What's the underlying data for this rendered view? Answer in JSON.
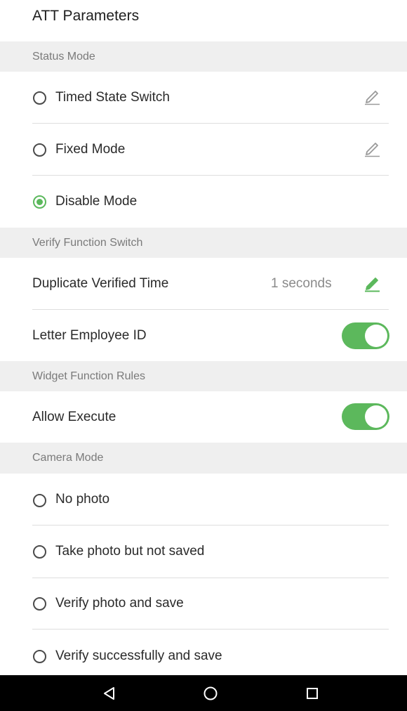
{
  "header": {
    "title": "ATT Parameters"
  },
  "sections": {
    "status_mode": "Status Mode",
    "verify_function": "Verify Function Switch",
    "widget_rules": "Widget Function Rules",
    "camera_mode": "Camera Mode"
  },
  "status_mode": {
    "timed_state_switch": "Timed State Switch",
    "fixed_mode": "Fixed Mode",
    "disable_mode": "Disable Mode",
    "selected": "Disable Mode"
  },
  "verify_function": {
    "duplicate_verified_time": {
      "label": "Duplicate Verified Time",
      "value": "1 seconds"
    },
    "letter_employee_id": {
      "label": "Letter Employee ID",
      "enabled": true
    }
  },
  "widget_rules": {
    "allow_execute": {
      "label": "Allow Execute",
      "enabled": true
    }
  },
  "camera_mode": {
    "no_photo": "No photo",
    "take_photo_not_saved": "Take photo but not saved",
    "verify_photo_save": "Verify photo and save",
    "verify_success_save": "Verify successfully and save"
  },
  "colors": {
    "accent": "#5bb85c",
    "section_bg": "#efefef",
    "nav_bg": "#000000"
  },
  "icons": {
    "edit": "pencil-icon",
    "back": "back-triangle-icon",
    "home": "home-circle-icon",
    "recents": "recents-square-icon"
  }
}
